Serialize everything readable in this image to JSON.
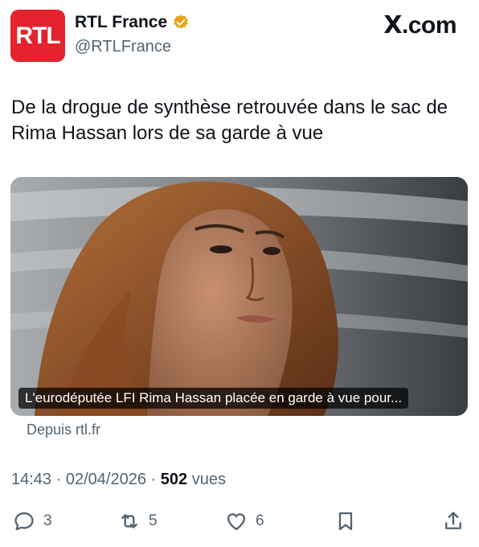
{
  "account": {
    "avatar_text": "RTL",
    "display_name": "RTL France",
    "handle": "@RTLFrance",
    "verified_color": "#e8a317"
  },
  "brand": {
    "logo_text": ".com",
    "logo_mark": "X"
  },
  "tweet": {
    "text": "De la drogue de synthèse retrouvée dans le sac de Rima Hassan lors de sa garde à vue"
  },
  "card": {
    "caption": "L'eurodéputée LFI Rima Hassan placée en garde à vue pour...",
    "source": "Depuis rtl.fr"
  },
  "meta": {
    "time": "14:43",
    "date": "02/04/2026",
    "views_count": "502",
    "views_label": "vues",
    "separator": "·"
  },
  "actions": {
    "replies": "3",
    "reposts": "5",
    "likes": "6"
  },
  "colors": {
    "accent_red": "#e4232e",
    "text_primary": "#0f1419",
    "text_secondary": "#536471"
  }
}
